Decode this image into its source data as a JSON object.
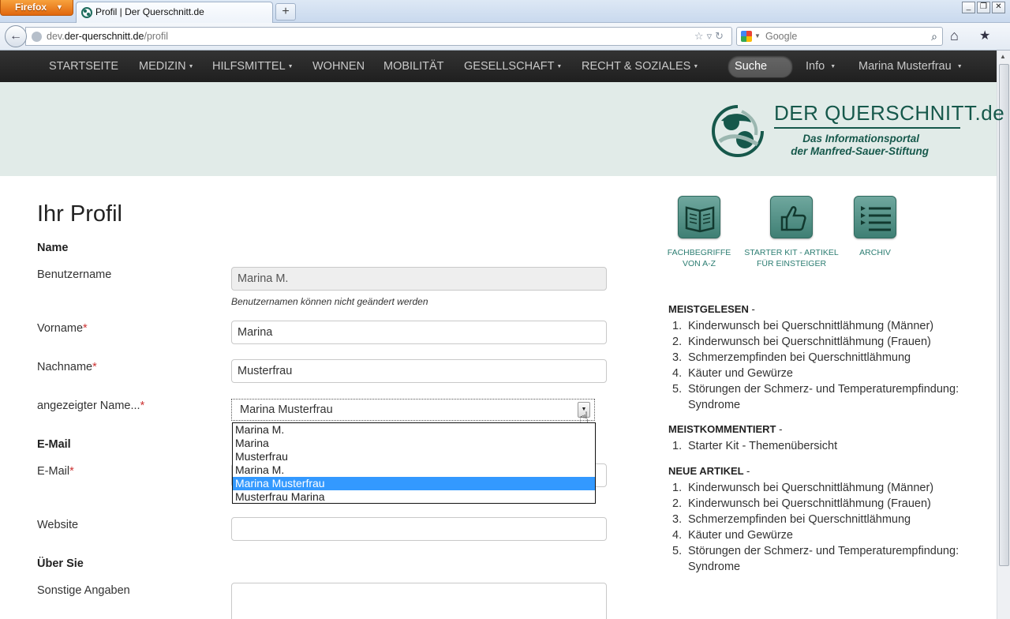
{
  "browser": {
    "app_button": "Firefox",
    "tab_title": "Profil | Der Querschnitt.de",
    "new_tab": "+",
    "url_prefix": "dev.",
    "url_domain": "der-querschnitt.de",
    "url_path": "/profil",
    "search_placeholder": "Google"
  },
  "site_nav": {
    "items": [
      {
        "label": "STARTSEITE",
        "caret": false
      },
      {
        "label": "MEDIZIN",
        "caret": true
      },
      {
        "label": "HILFSMITTEL",
        "caret": true
      },
      {
        "label": "WOHNEN",
        "caret": false
      },
      {
        "label": "MOBILITÄT",
        "caret": false
      },
      {
        "label": "GESELLSCHAFT",
        "caret": true
      },
      {
        "label": "RECHT & SOZIALES",
        "caret": true
      }
    ],
    "search_label": "Suche",
    "info_label": "Info",
    "user_label": "Marina Musterfrau"
  },
  "logo": {
    "title": "DER QUERSCHNITT.de",
    "subtitle_line1": "Das Informationsportal",
    "subtitle_line2": "der Manfred-Sauer-Stiftung",
    "color": "#16584b"
  },
  "form": {
    "page_title": "Ihr Profil",
    "section_name": "Name",
    "username_label": "Benutzername",
    "username_value": "Marina M.",
    "username_hint": "Benutzernamen können nicht geändert werden",
    "firstname_label": "Vorname",
    "firstname_value": "Marina",
    "lastname_label": "Nachname",
    "lastname_value": "Musterfrau",
    "displayname_label": "angezeigter Name...",
    "displayname_value": "Marina Musterfrau",
    "displayname_options": [
      "Marina M.",
      "Marina",
      "Musterfrau",
      "Marina M.",
      "Marina Musterfrau",
      "Musterfrau Marina"
    ],
    "displayname_selected_index": 4,
    "required_mark": "*",
    "section_email": "E-Mail",
    "email_label": "E-Mail",
    "website_label": "Website",
    "section_about": "Über Sie",
    "other_label": "Sonstige Angaben"
  },
  "sidebar": {
    "tiles": [
      {
        "line1": "FACHBEGRIFFE",
        "line2": "VON A-Z"
      },
      {
        "line1": "STARTER KIT - ARTIKEL",
        "line2": "FÜR EINSTEIGER"
      },
      {
        "line1": "ARCHIV",
        "line2": ""
      }
    ],
    "most_read_title": "MEISTGELESEN",
    "most_read": [
      "Kinderwunsch bei Querschnittlähmung (Männer)",
      "Kinderwunsch bei Querschnittlähmung (Frauen)",
      "Schmerzempfinden bei Querschnittlähmung",
      "Käuter und Gewürze",
      "Störungen der Schmerz- und Temperaturempfindung:",
      "Syndrome"
    ],
    "most_commented_title": "MEISTKOMMENTIERT",
    "most_commented": [
      "Starter Kit - Themenübersicht"
    ],
    "new_articles_title": "NEUE ARTIKEL",
    "new_articles": [
      "Kinderwunsch bei Querschnittlähmung (Männer)",
      "Kinderwunsch bei Querschnittlähmung (Frauen)",
      "Schmerzempfinden bei Querschnittlähmung",
      "Käuter und Gewürze",
      "Störungen der Schmerz- und Temperaturempfindung:",
      "Syndrome"
    ],
    "title_separator": "-",
    "accent_color": "#2c7d72"
  }
}
